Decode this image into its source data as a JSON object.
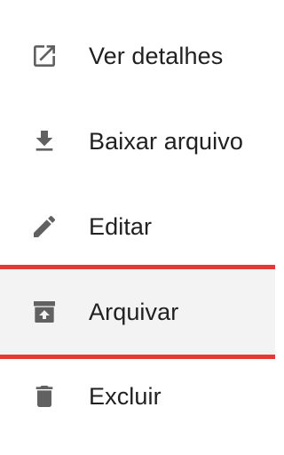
{
  "menu": {
    "items": [
      {
        "label": "Ver detalhes",
        "icon": "open-in-new-icon"
      },
      {
        "label": "Baixar arquivo",
        "icon": "download-icon"
      },
      {
        "label": "Editar",
        "icon": "edit-pencil-icon"
      },
      {
        "label": "Arquivar",
        "icon": "unarchive-icon",
        "highlighted": true
      },
      {
        "label": "Excluir",
        "icon": "trash-icon"
      }
    ],
    "highlight_color": "#e53935",
    "highlight_bg": "#f3f3f3",
    "icon_color": "#616161"
  }
}
